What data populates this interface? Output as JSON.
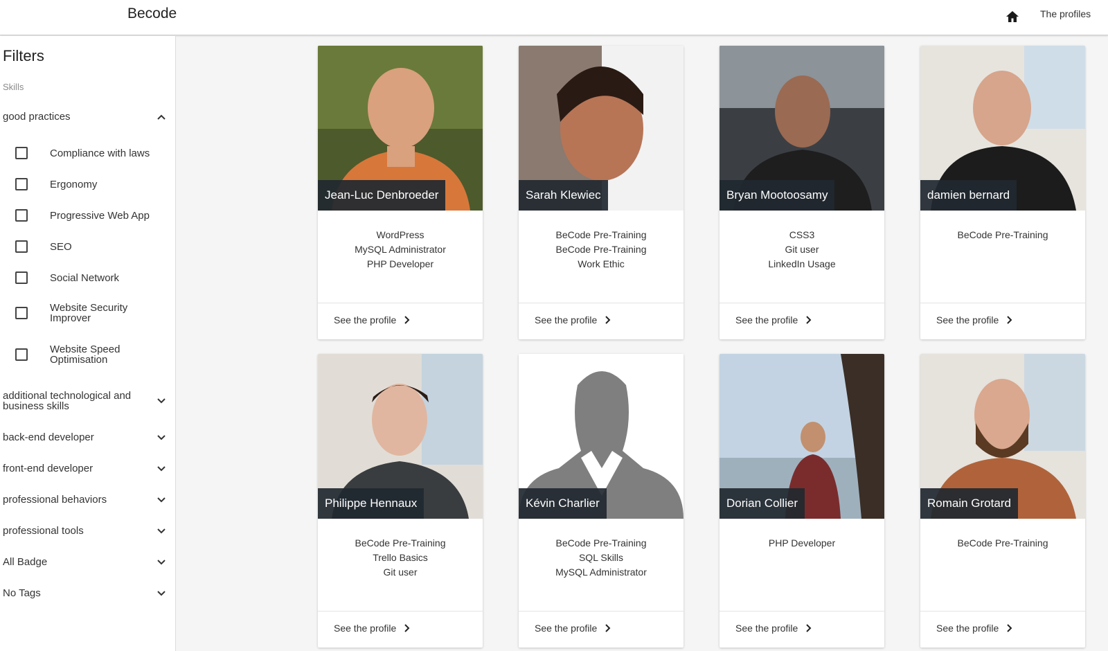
{
  "header": {
    "brand": "Becode",
    "nav_profiles": "The profiles",
    "home_icon": "home-icon"
  },
  "sidebar": {
    "title": "Filters",
    "subtitle": "Skills",
    "expanded_group": {
      "label": "good practices",
      "options": [
        {
          "label": "Compliance with laws",
          "checked": false
        },
        {
          "label": "Ergonomy",
          "checked": false
        },
        {
          "label": "Progressive Web App",
          "checked": false
        },
        {
          "label": "SEO",
          "checked": false
        },
        {
          "label": "Social Network",
          "checked": false
        },
        {
          "label": "Website Security Improver",
          "checked": false
        },
        {
          "label": "Website Speed Optimisation",
          "checked": false
        }
      ]
    },
    "collapsed_groups": [
      "additional technological and business skills",
      "back-end developer",
      "front-end developer",
      "professional behaviors",
      "professional tools",
      "All Badge",
      "No Tags"
    ]
  },
  "profiles": [
    {
      "name": "Jean-Luc Denbroeder",
      "skills": [
        "WordPress",
        "MySQL Administrator",
        "PHP Developer"
      ],
      "cta": "See the profile"
    },
    {
      "name": "Sarah Klewiec",
      "skills": [
        "BeCode Pre-Training",
        "BeCode Pre-Training",
        "Work Ethic"
      ],
      "cta": "See the profile"
    },
    {
      "name": "Bryan Mootoosamy",
      "skills": [
        "CSS3",
        "Git user",
        "LinkedIn Usage"
      ],
      "cta": "See the profile"
    },
    {
      "name": "damien bernard",
      "skills": [
        "BeCode Pre-Training"
      ],
      "cta": "See the profile"
    },
    {
      "name": "Philippe Hennaux",
      "skills": [
        "BeCode Pre-Training",
        "Trello Basics",
        "Git user"
      ],
      "cta": "See the profile"
    },
    {
      "name": "Kévin Charlier",
      "skills": [
        "BeCode Pre-Training",
        "SQL Skills",
        "MySQL Administrator"
      ],
      "cta": "See the profile"
    },
    {
      "name": "Dorian Collier",
      "skills": [
        "PHP Developer"
      ],
      "cta": "See the profile"
    },
    {
      "name": "Romain Grotard",
      "skills": [
        "BeCode Pre-Training"
      ],
      "cta": "See the profile"
    }
  ]
}
